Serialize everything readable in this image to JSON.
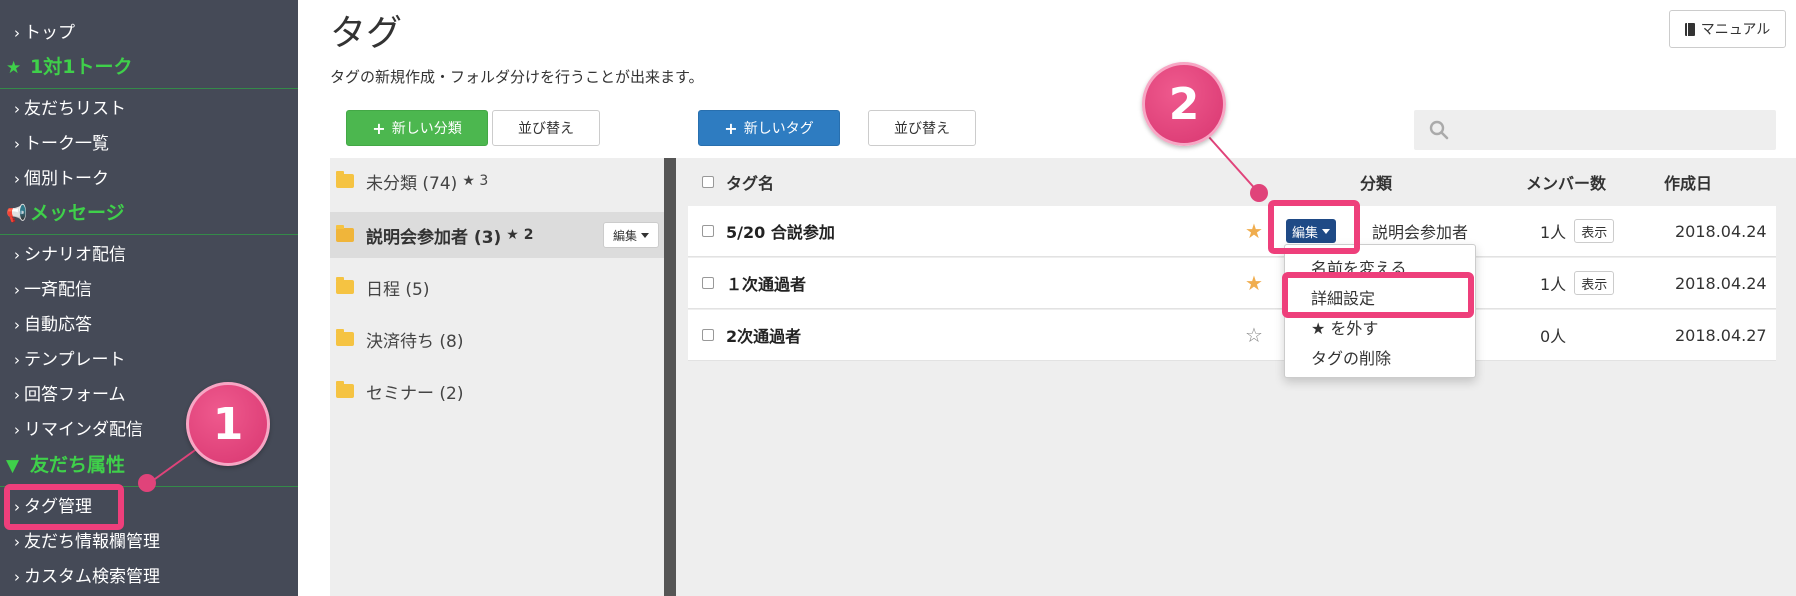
{
  "sidebar": {
    "items": [
      {
        "label": "トップ"
      },
      {
        "label": "友だちリスト"
      },
      {
        "label": "トーク一覧"
      },
      {
        "label": "個別トーク"
      },
      {
        "label": "シナリオ配信"
      },
      {
        "label": "一斉配信"
      },
      {
        "label": "自動応答"
      },
      {
        "label": "テンプレート"
      },
      {
        "label": "回答フォーム"
      },
      {
        "label": "リマインダ配信"
      },
      {
        "label": "タグ管理"
      },
      {
        "label": "友だち情報欄管理"
      },
      {
        "label": "カスタム検索管理"
      }
    ],
    "sections": [
      {
        "label": "1対1トーク",
        "icon": "star-icon"
      },
      {
        "label": "メッセージ",
        "icon": "megaphone-icon"
      },
      {
        "label": "友だち属性",
        "icon": "filter-icon"
      }
    ]
  },
  "header": {
    "title": "タグ",
    "description": "タグの新規作成・フォルダ分けを行うことが出来ます。",
    "manual_label": "マニュアル"
  },
  "toolbar": {
    "new_category": "新しい分類",
    "sort_category": "並び替え",
    "new_tag": "新しいタグ",
    "sort_tag": "並び替え",
    "search_placeholder": ""
  },
  "folders": [
    {
      "name": "未分類 (74)",
      "star": "★ 3",
      "active": false
    },
    {
      "name": "説明会参加者 (3)",
      "star": "★ 2",
      "active": true
    },
    {
      "name": "日程 (5)",
      "star": "",
      "active": false
    },
    {
      "name": "決済待ち (8)",
      "star": "",
      "active": false
    },
    {
      "name": "セミナー (2)",
      "star": "",
      "active": false
    }
  ],
  "folder_edit_label": "編集",
  "table": {
    "headers": {
      "name": "タグ名",
      "category": "分類",
      "members": "メンバー数",
      "created": "作成日"
    },
    "rows": [
      {
        "name": "5/20 合説参加",
        "starred": true,
        "category": "説明会参加者",
        "members": "1人",
        "show": "表示",
        "created": "2018.04.24"
      },
      {
        "name": "１次通過者",
        "starred": true,
        "category": "",
        "members": "1人",
        "show": "表示",
        "created": "2018.04.24"
      },
      {
        "name": "2次通過者",
        "starred": false,
        "category": "",
        "members": "0人",
        "show": "",
        "created": "2018.04.27"
      }
    ],
    "edit_label": "編集"
  },
  "dropdown": {
    "items": [
      "名前を変える",
      "詳細設定",
      "★ を外す",
      "タグの削除"
    ]
  },
  "annotations": {
    "badge1": "1",
    "badge2": "2"
  },
  "colors": {
    "sidebar_bg": "#454a57",
    "section_green": "#3fd04a",
    "highlight_pink": "#ee3f7b",
    "btn_green": "#4cb74f",
    "btn_blue": "#2e7cc1",
    "edit_navy": "#1f4a86",
    "star_gold": "#f0ad4e"
  }
}
